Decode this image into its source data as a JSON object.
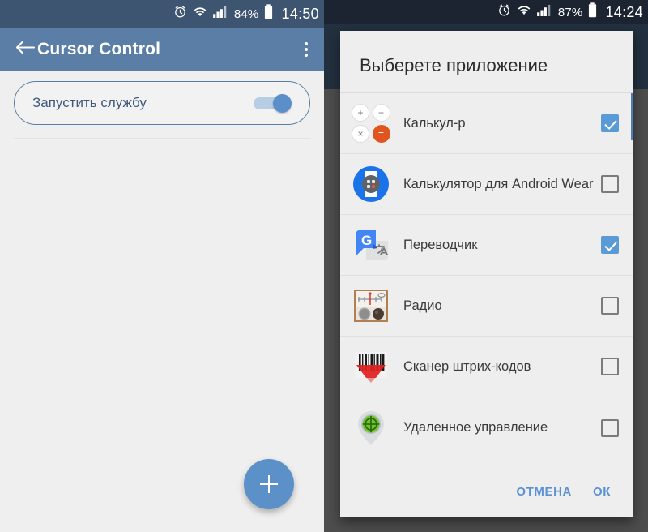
{
  "left_screen": {
    "statusbar": {
      "alarm_icon": "alarm-icon",
      "wifi_icon": "wifi-icon",
      "signal_icon": "signal-icon",
      "battery_percent": "84%",
      "battery_icon": "battery-icon",
      "time": "14:50"
    },
    "appbar": {
      "back_icon": "back-arrow-icon",
      "title": "Cursor Control",
      "overflow_icon": "overflow-menu-icon"
    },
    "toggle_card": {
      "label": "Запустить службу",
      "checked": true
    },
    "fab": {
      "icon": "plus-icon",
      "color": "#5b91c8"
    }
  },
  "right_screen": {
    "statusbar": {
      "alarm_icon": "alarm-icon",
      "wifi_icon": "wifi-icon",
      "signal_icon": "signal-icon",
      "battery_percent": "87%",
      "battery_icon": "battery-icon",
      "time": "14:24"
    },
    "dialog": {
      "title": "Выберете приложение",
      "apps": [
        {
          "name": "Калькул-р",
          "icon": "calculator-icon",
          "checked": true
        },
        {
          "name": "Калькулятор для Android Wear",
          "icon": "android-wear-calculator-icon",
          "checked": false
        },
        {
          "name": "Переводчик",
          "icon": "google-translate-icon",
          "checked": true
        },
        {
          "name": "Радио",
          "icon": "radio-icon",
          "checked": false
        },
        {
          "name": "Сканер штрих-кодов",
          "icon": "barcode-scanner-icon",
          "checked": false
        },
        {
          "name": "Удаленное управление",
          "icon": "remote-control-pin-icon",
          "checked": false
        }
      ],
      "cancel_label": "ОТМЕНА",
      "ok_label": "ОК"
    }
  },
  "colors": {
    "left_statusbar": "#3d5571",
    "left_appbar": "#5b7ea6",
    "accent_blue": "#5b9bd5",
    "right_statusbar": "#1b2430",
    "right_background": "#22303f",
    "scrim": "#4d4d4d",
    "calculator_orange": "#e0551f"
  }
}
